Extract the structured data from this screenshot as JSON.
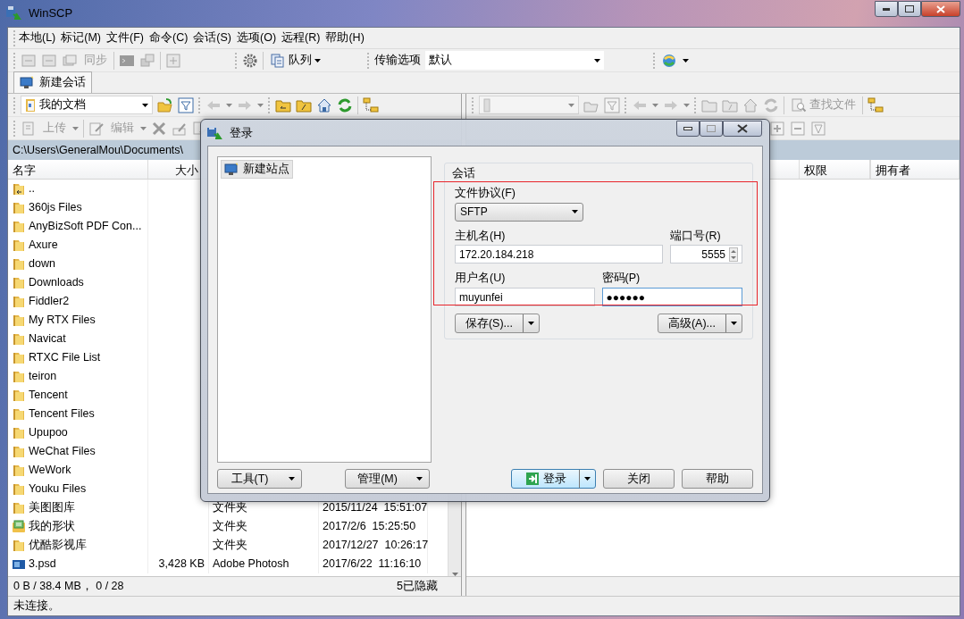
{
  "window": {
    "title": "WinSCP"
  },
  "menu": [
    {
      "label": "本地(L)"
    },
    {
      "label": "标记(M)"
    },
    {
      "label": "文件(F)"
    },
    {
      "label": "命令(C)"
    },
    {
      "label": "会话(S)"
    },
    {
      "label": "选项(O)"
    },
    {
      "label": "远程(R)"
    },
    {
      "label": "帮助(H)"
    }
  ],
  "toolbar": {
    "sync": {
      "label": "同步",
      "disabled": true
    },
    "queue": {
      "label": "队列",
      "disabled": false
    },
    "transfer_label": "传输选项",
    "transfer_value": "默认"
  },
  "session_tabs": [
    {
      "label": "新建会话",
      "selected": true
    }
  ],
  "local_panel": {
    "location": "我的文档",
    "upload": {
      "label": "上传",
      "disabled": true
    },
    "edit": {
      "label": "编辑",
      "disabled": true
    },
    "path": "C:\\Users\\GeneralMou\\Documents\\",
    "columns": [
      "名字",
      "大小"
    ],
    "rows": [
      {
        "kind": "parent",
        "name": ".."
      },
      {
        "kind": "folder",
        "name": "360js Files"
      },
      {
        "kind": "folder",
        "name": "AnyBizSoft PDF Con..."
      },
      {
        "kind": "folder",
        "name": "Axure"
      },
      {
        "kind": "folder",
        "name": "down"
      },
      {
        "kind": "folder",
        "name": "Downloads"
      },
      {
        "kind": "folder",
        "name": "Fiddler2"
      },
      {
        "kind": "folder",
        "name": "My RTX Files"
      },
      {
        "kind": "folder",
        "name": "Navicat"
      },
      {
        "kind": "folder",
        "name": "RTXC File List"
      },
      {
        "kind": "folder",
        "name": "teiron"
      },
      {
        "kind": "folder",
        "name": "Tencent"
      },
      {
        "kind": "folder",
        "name": "Tencent Files"
      },
      {
        "kind": "folder",
        "name": "Upupoo"
      },
      {
        "kind": "folder",
        "name": "WeChat Files"
      },
      {
        "kind": "folder",
        "name": "WeWork"
      },
      {
        "kind": "folder",
        "name": "Youku Files"
      },
      {
        "kind": "folder",
        "name": "美图图库",
        "type": "文件夹",
        "modified": "2015/11/24  15:51:07"
      },
      {
        "kind": "shapes",
        "name": "我的形状",
        "type": "文件夹",
        "modified": "2017/2/6  15:25:50"
      },
      {
        "kind": "folder",
        "name": "优酷影视库",
        "type": "文件夹",
        "modified": "2017/12/27  10:26:17"
      },
      {
        "kind": "image",
        "name": "3.psd",
        "size": "3,428 KB",
        "type": "Adobe Photosh",
        "modified": "2017/6/22  11:16:10"
      }
    ]
  },
  "remote_panel": {
    "find": {
      "label": "查找文件",
      "disabled": true
    },
    "columns": [
      "权限",
      "拥有者"
    ]
  },
  "status": {
    "selection": "0 B / 38.4 MB， 0 / 28",
    "hidden": "5已隐藏",
    "connection": "未连接。"
  },
  "login_dialog": {
    "title": "登录",
    "sites": [
      {
        "label": "新建站点",
        "selected": true
      }
    ],
    "group_title": "会话",
    "protocol_label": "文件协议(F)",
    "protocol": "SFTP",
    "host_label": "主机名(H)",
    "host": "172.20.184.218",
    "port_label": "端口号(R)",
    "port": "5555",
    "user_label": "用户名(U)",
    "user": "muyunfei",
    "password_label": "密码(P)",
    "password": "●●●●●●",
    "group_buttons": [
      {
        "label": "保存(S)...",
        "kind": "split"
      },
      {
        "label": "高级(A)...",
        "kind": "split"
      }
    ],
    "footer_left": [
      {
        "label": "工具(T)",
        "kind": "dropdown"
      },
      {
        "label": "管理(M)",
        "kind": "dropdown"
      }
    ],
    "footer_right": [
      {
        "label": "登录",
        "kind": "split",
        "default": true
      },
      {
        "label": "关闭",
        "kind": "plain",
        "default": false
      },
      {
        "label": "帮助",
        "kind": "plain",
        "default": false
      }
    ]
  }
}
